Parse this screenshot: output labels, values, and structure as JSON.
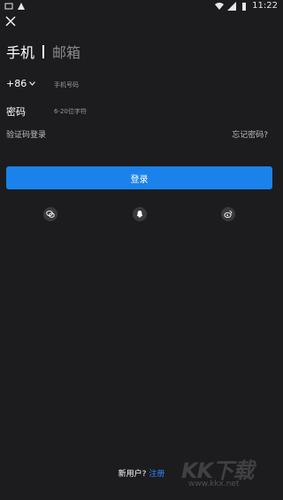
{
  "status_bar": {
    "time": "11:22"
  },
  "header": {
    "tab_phone": "手机",
    "tab_email": "邮箱"
  },
  "form": {
    "country_code": "+86",
    "phone_placeholder": "手机号码",
    "password_label": "密码",
    "password_placeholder": "6-20位字符",
    "sms_login": "验证码登录",
    "forgot_password": "忘记密码?",
    "login_button": "登录"
  },
  "social": [
    "wechat-icon",
    "qq-icon",
    "weibo-icon"
  ],
  "footer": {
    "new_user": "新用户?",
    "register": "注册"
  },
  "watermark": {
    "logo": "KK下载",
    "url": "www.kkx.net"
  },
  "colors": {
    "background": "#1c1c1e",
    "accent": "#1a82ea",
    "link": "#2f86ff"
  }
}
